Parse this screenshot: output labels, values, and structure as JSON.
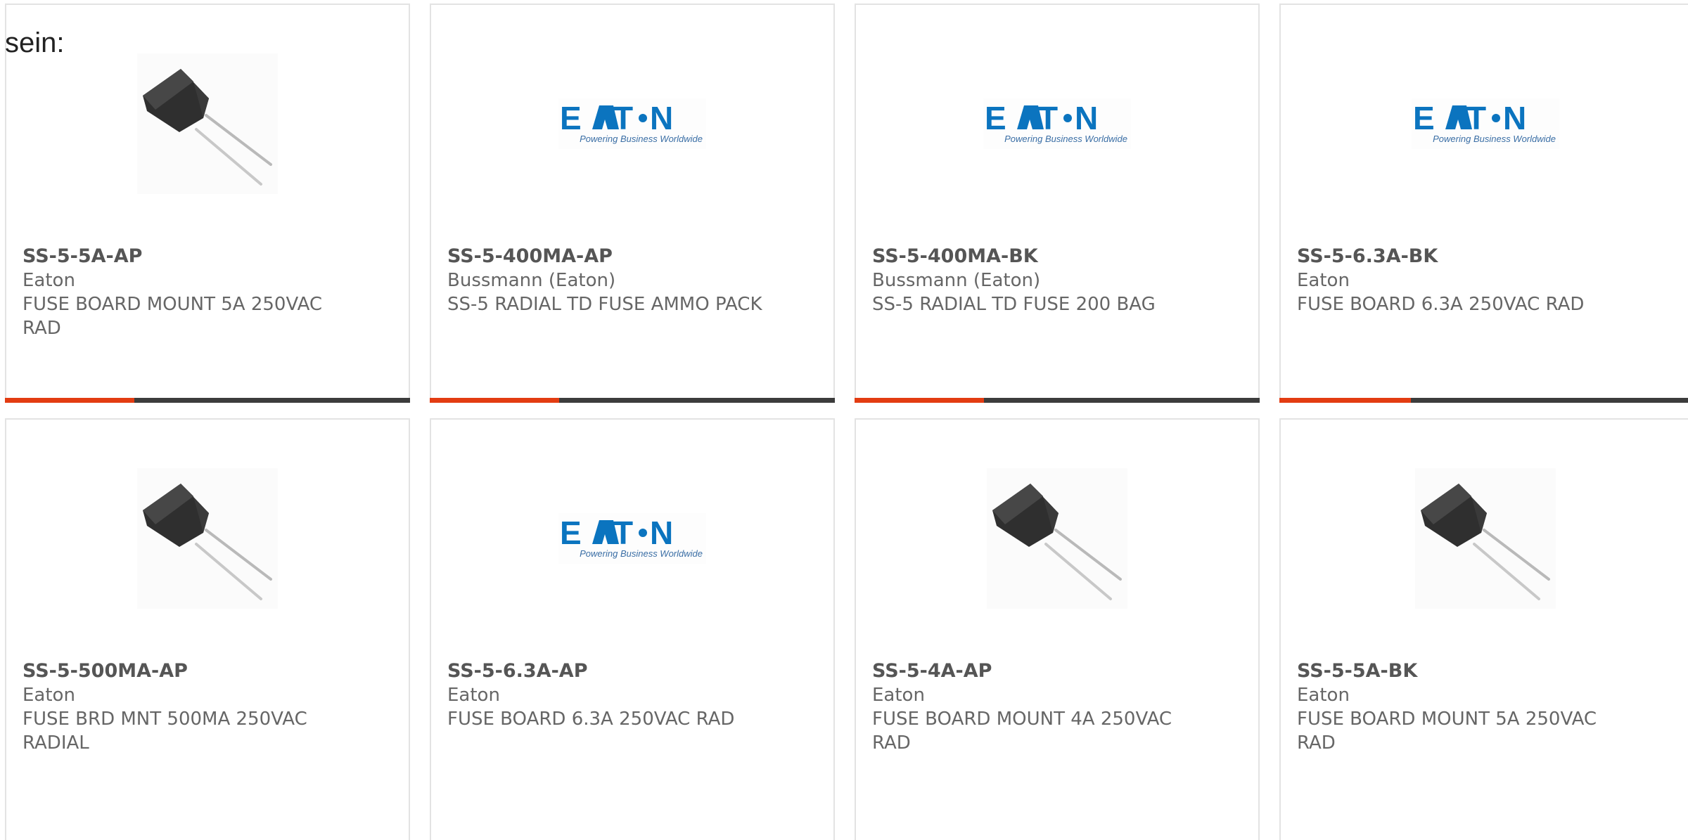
{
  "heading": "sein:",
  "accent_color": "#e33c12",
  "bar_color": "#3c3c3c",
  "logo": {
    "text_left": "E",
    "text_mid": "T",
    "text_right": "N",
    "tagline": "Powering Business Worldwide",
    "color": "#0b74bf"
  },
  "products": [
    {
      "part": "SS-5-5A-AP",
      "brand": "Eaton",
      "description": "FUSE BOARD MOUNT 5A 250VAC RAD",
      "image": "fuse-icon",
      "progress": 0.32
    },
    {
      "part": "SS-5-400MA-AP",
      "brand": "Bussmann (Eaton)",
      "description": "SS-5 RADIAL TD FUSE AMMO PACK",
      "image": "eaton-logo",
      "progress": 0.32
    },
    {
      "part": "SS-5-400MA-BK",
      "brand": "Bussmann (Eaton)",
      "description": "SS-5 RADIAL TD FUSE 200 BAG",
      "image": "eaton-logo",
      "progress": 0.32
    },
    {
      "part": "SS-5-6.3A-BK",
      "brand": "Eaton",
      "description": "FUSE BOARD 6.3A 250VAC RAD",
      "image": "eaton-logo",
      "progress": 0.32
    },
    {
      "part": "SS-5-500MA-AP",
      "brand": "Eaton",
      "description": "FUSE BRD MNT 500MA 250VAC RADIAL",
      "image": "fuse-icon"
    },
    {
      "part": "SS-5-6.3A-AP",
      "brand": "Eaton",
      "description": "FUSE BOARD 6.3A 250VAC RAD",
      "image": "eaton-logo"
    },
    {
      "part": "SS-5-4A-AP",
      "brand": "Eaton",
      "description": "FUSE BOARD MOUNT 4A 250VAC RAD",
      "image": "fuse-icon"
    },
    {
      "part": "SS-5-5A-BK",
      "brand": "Eaton",
      "description": "FUSE BOARD MOUNT 5A 250VAC RAD",
      "image": "fuse-icon"
    }
  ]
}
